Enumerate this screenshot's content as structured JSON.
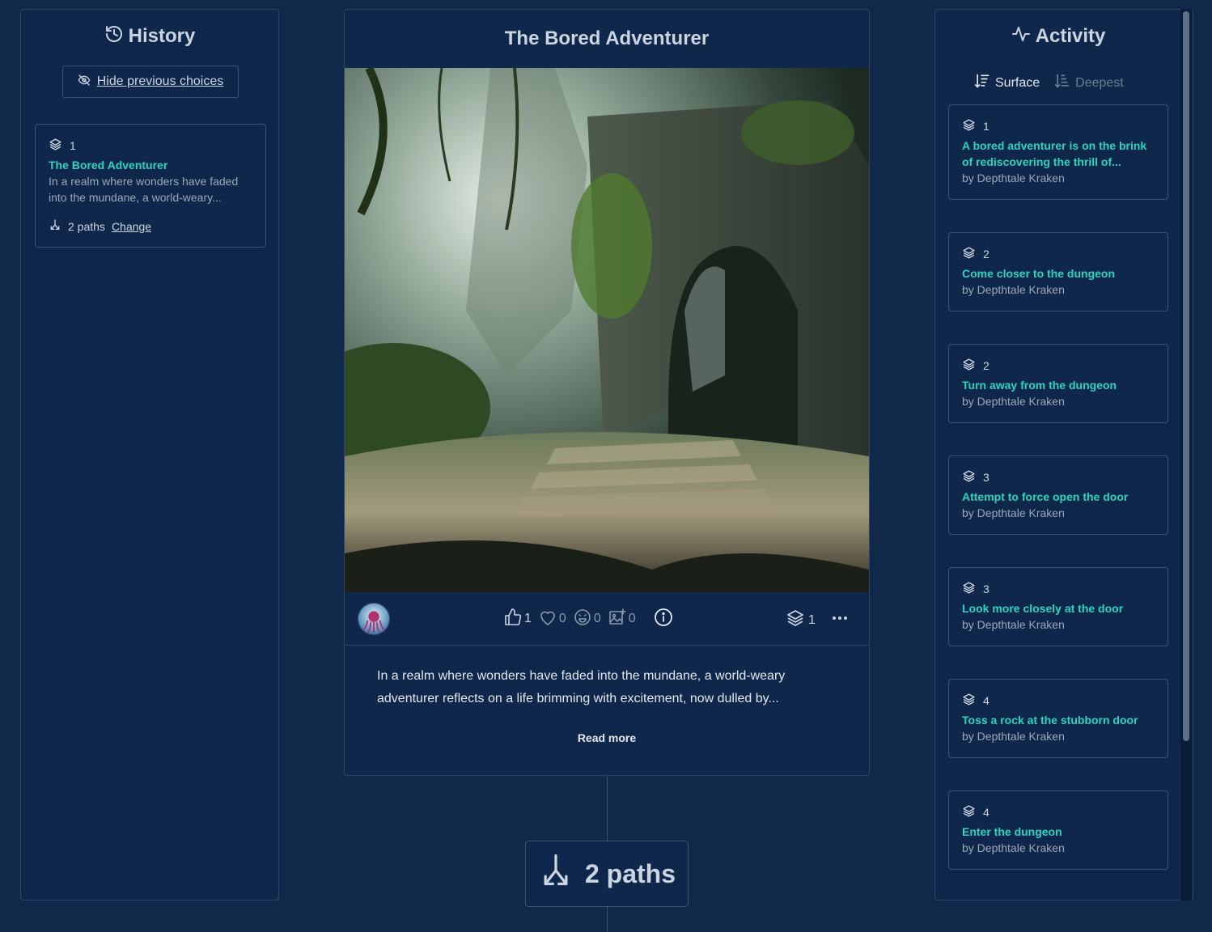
{
  "history": {
    "title": "History",
    "hide_label": "Hide previous choices",
    "card": {
      "layer": "1",
      "title": "The Bored Adventurer",
      "desc": "In a realm where wonders have faded into the mundane, a world-weary...",
      "paths": "2 paths",
      "change": "Change"
    }
  },
  "story": {
    "title": "The Bored Adventurer",
    "likes": "1",
    "hearts": "0",
    "laughs": "0",
    "images": "0",
    "layers": "1",
    "text": "In a realm where wonders have faded into the mundane, a world-weary adventurer reflects on a life brimming with excitement, now dulled by...",
    "read_more": "Read more",
    "paths_label": "2 paths"
  },
  "activity": {
    "title": "Activity",
    "sort_surface": "Surface",
    "sort_deepest": "Deepest",
    "items": [
      {
        "layer": "1",
        "title": "A bored adventurer is on the brink of rediscovering the thrill of...",
        "by": "by Depthtale Kraken"
      },
      {
        "layer": "2",
        "title": "Come closer to the dungeon",
        "by": "by Depthtale Kraken"
      },
      {
        "layer": "2",
        "title": "Turn away from the dungeon",
        "by": "by Depthtale Kraken"
      },
      {
        "layer": "3",
        "title": "Attempt to force open the door",
        "by": "by Depthtale Kraken"
      },
      {
        "layer": "3",
        "title": "Look more closely at the door",
        "by": "by Depthtale Kraken"
      },
      {
        "layer": "4",
        "title": "Toss a rock at the stubborn door",
        "by": "by Depthtale Kraken"
      },
      {
        "layer": "4",
        "title": "Enter the dungeon",
        "by": "by Depthtale Kraken"
      }
    ]
  },
  "colors": {
    "background": "#10284a",
    "accent": "#2dd4bf",
    "border": "#3a5274"
  }
}
